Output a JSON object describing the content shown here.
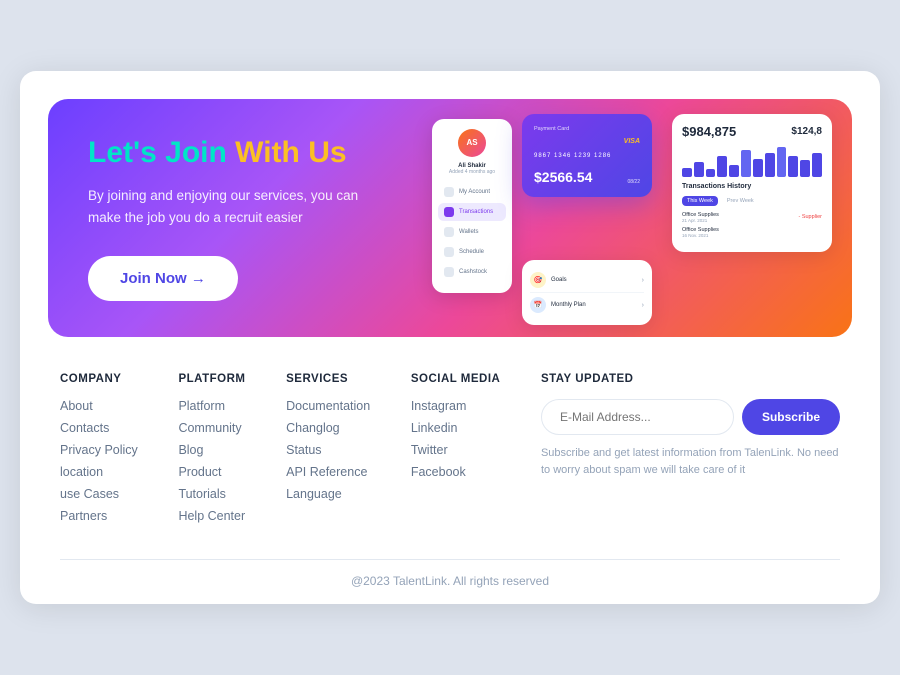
{
  "hero": {
    "title_part1": "Let's Join ",
    "title_part2": "With Us",
    "subtitle": "By joining and enjoying our services, you can make the job you do a recruit easier",
    "cta_label": "Join Now →"
  },
  "mockup": {
    "user_name": "Ali Shakir",
    "user_sub": "Added 4 months ago",
    "nav_items": [
      {
        "label": "My Account",
        "active": false
      },
      {
        "label": "Transactions",
        "active": true
      },
      {
        "label": "Wallets",
        "active": false
      },
      {
        "label": "Schedule",
        "active": false
      },
      {
        "label": "Cashstock",
        "active": false
      }
    ],
    "card": {
      "label": "Payment Card",
      "network": "VISA",
      "number": "9867 1346 1239 1286",
      "amount": "$2566.54",
      "expiry": "08/22"
    },
    "stats": {
      "main_value": "$984,875",
      "small_value": "$124,8",
      "bars": [
        8,
        12,
        6,
        18,
        10,
        22,
        15,
        20,
        25,
        18,
        14,
        20
      ],
      "tx_title": "Transactions History",
      "tab_this_week": "This Week",
      "tab_prev_week": "Prev Week",
      "transactions": [
        {
          "name": "Office Supplies",
          "date": "21 Apr. 2021",
          "amount": "- Supplier"
        },
        {
          "name": "Office Supplies",
          "date": "16 Nov. 2021",
          "amount": ""
        }
      ]
    },
    "goals": [
      {
        "icon": "🎯",
        "label": "Goals",
        "color": "#fef3c7"
      },
      {
        "icon": "📅",
        "label": "Monthly Plan",
        "color": "#dbeafe"
      }
    ]
  },
  "footer": {
    "columns": [
      {
        "title": "COMPANY",
        "links": [
          "About",
          "Contacts",
          "Privacy Policy",
          "location",
          "use Cases",
          "Partners"
        ]
      },
      {
        "title": "PLATFORM",
        "links": [
          "Platform",
          "Community",
          "Blog",
          "Product",
          "Tutorials",
          "Help Center"
        ]
      },
      {
        "title": "SERVICES",
        "links": [
          "Documentation",
          "Changlog",
          "Status",
          "API Reference",
          "Language"
        ]
      },
      {
        "title": "SOCIAL MEDIA",
        "links": [
          "Instagram",
          "Linkedin",
          "Twitter",
          "Facebook"
        ]
      }
    ],
    "newsletter": {
      "title": "STAY UPDATED",
      "placeholder": "E-Mail Address...",
      "button_label": "Subscribe",
      "note": "Subscribe and get latest information from TalenLink. No need to worry about spam we will take care of it"
    },
    "copyright": "@2023 TalentLink. All rights reserved"
  }
}
